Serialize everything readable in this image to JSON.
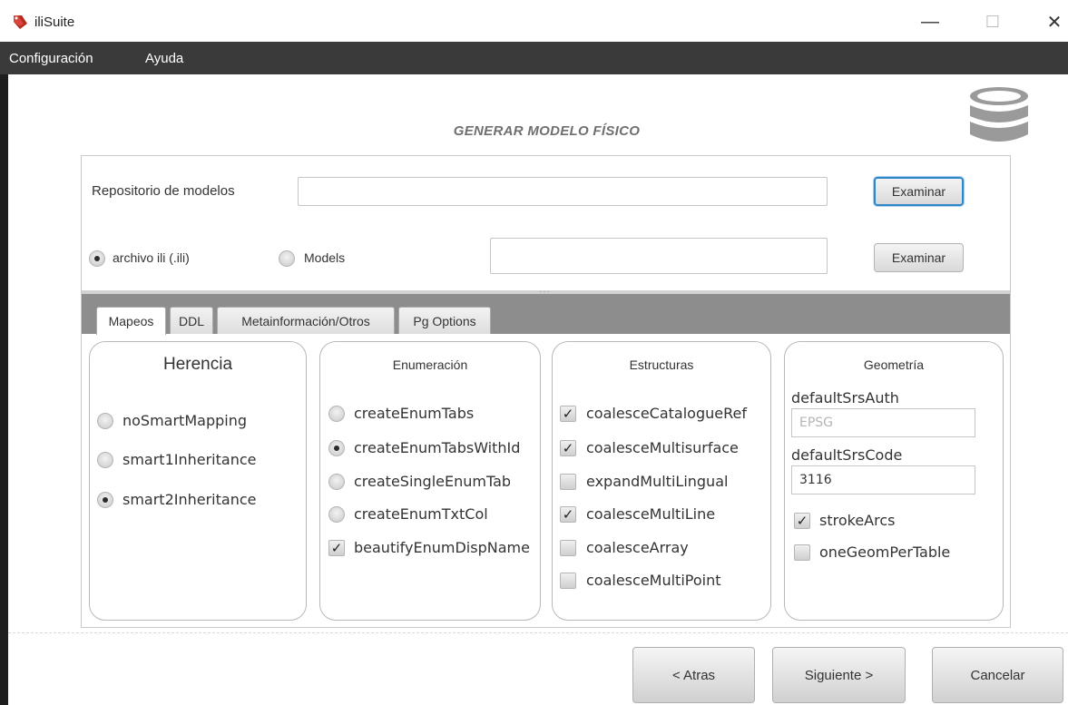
{
  "window": {
    "title": "iliSuite",
    "minimize_label": "—",
    "maximize_label": "☐",
    "close_label": "✕"
  },
  "menu": {
    "items": [
      "Configuración",
      "Ayuda"
    ]
  },
  "page": {
    "title": "GENERAR MODELO FÍSICO",
    "icon": "database-icon"
  },
  "source": {
    "repo_label": "Repositorio de modelos",
    "repo_value": "",
    "browse_label": "Examinar",
    "option_ili": "archivo ili (.ili)",
    "option_models": "Models",
    "selected": "archivo ili (.ili)",
    "file_value": "",
    "browse2_label": "Examinar"
  },
  "tabs": [
    {
      "label": "Mapeos",
      "active": true
    },
    {
      "label": "DDL",
      "active": false
    },
    {
      "label": "Metainformación/Otros",
      "active": false
    },
    {
      "label": "Pg Options",
      "active": false
    }
  ],
  "herencia": {
    "title": "Herencia",
    "options": [
      {
        "label": "noSmartMapping",
        "checked": false
      },
      {
        "label": "smart1Inheritance",
        "checked": false
      },
      {
        "label": "smart2Inheritance",
        "checked": true
      }
    ]
  },
  "enumeracion": {
    "title": "Enumeración",
    "radios": [
      {
        "label": "createEnumTabs",
        "checked": false
      },
      {
        "label": "createEnumTabsWithId",
        "checked": true
      },
      {
        "label": "createSingleEnumTab",
        "checked": false
      },
      {
        "label": "createEnumTxtCol",
        "checked": false
      }
    ],
    "checkbox": {
      "label": "beautifyEnumDispName",
      "checked": true
    }
  },
  "estructuras": {
    "title": "Estructuras",
    "options": [
      {
        "label": "coalesceCatalogueRef",
        "checked": true
      },
      {
        "label": "coalesceMultisurface",
        "checked": true
      },
      {
        "label": "expandMultiLingual",
        "checked": false
      },
      {
        "label": "coalesceMultiLine",
        "checked": true
      },
      {
        "label": "coalesceArray",
        "checked": false
      },
      {
        "label": "coalesceMultiPoint",
        "checked": false
      }
    ]
  },
  "geometria": {
    "title": "Geometría",
    "srs_auth_label": "defaultSrsAuth",
    "srs_auth_placeholder": "EPSG",
    "srs_code_label": "defaultSrsCode",
    "srs_code_value": "3116",
    "options": [
      {
        "label": "strokeArcs",
        "checked": true
      },
      {
        "label": "oneGeomPerTable",
        "checked": false
      }
    ]
  },
  "nav": {
    "back_label": "< Atras",
    "next_label": "Siguiente >",
    "cancel_label": "Cancelar"
  }
}
